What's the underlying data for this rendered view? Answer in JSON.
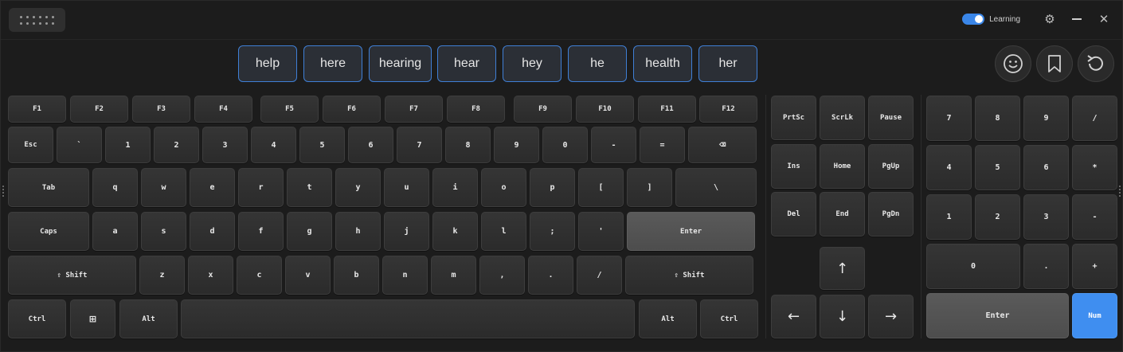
{
  "titlebar": {
    "learning_label": "Learning",
    "learning_on": true,
    "settings_icon": "gear-icon",
    "minimize_icon": "minimize-icon",
    "close_icon": "close-icon",
    "close_glyph": "✕",
    "gear_glyph": "⚙"
  },
  "suggestions": [
    "help",
    "here",
    "hearing",
    "hear",
    "hey",
    "he",
    "health",
    "her"
  ],
  "tools": [
    "emoji-icon",
    "bookmark-icon",
    "reset-icon"
  ],
  "main_keys": {
    "function_row": [
      "F1",
      "F2",
      "F3",
      "F4",
      "F5",
      "F6",
      "F7",
      "F8",
      "F9",
      "F10",
      "F11",
      "F12"
    ],
    "number_row": [
      "Esc",
      "`",
      "1",
      "2",
      "3",
      "4",
      "5",
      "6",
      "7",
      "8",
      "9",
      "0",
      "-",
      "=",
      "⌫"
    ],
    "q_row": [
      "Tab",
      "q",
      "w",
      "e",
      "r",
      "t",
      "y",
      "u",
      "i",
      "o",
      "p",
      "[",
      "]",
      "\\"
    ],
    "a_row": [
      "Caps",
      "a",
      "s",
      "d",
      "f",
      "g",
      "h",
      "j",
      "k",
      "l",
      ";",
      "'",
      "Enter"
    ],
    "z_row": [
      "⇧ Shift",
      "z",
      "x",
      "c",
      "v",
      "b",
      "n",
      "m",
      ",",
      ".",
      "/",
      "⇧ Shift"
    ],
    "bottom_row": [
      "Ctrl",
      "⊞",
      "Alt",
      "",
      "Alt",
      "Ctrl"
    ]
  },
  "nav_keys": {
    "row1": [
      "PrtSc",
      "ScrLk",
      "Pause"
    ],
    "row2": [
      "Ins",
      "Home",
      "PgUp"
    ],
    "row3": [
      "Del",
      "End",
      "PgDn"
    ],
    "arrows": {
      "up": "↑",
      "left": "←",
      "down": "↓",
      "right": "→"
    }
  },
  "numpad": {
    "row1": [
      "7",
      "8",
      "9",
      "/"
    ],
    "row2": [
      "4",
      "5",
      "6",
      "*"
    ],
    "row3": [
      "1",
      "2",
      "3",
      "-"
    ],
    "row4": [
      "0",
      ".",
      "+"
    ],
    "row5": [
      "Enter",
      "Num"
    ]
  },
  "colors": {
    "accent": "#3f8ef0",
    "background": "#1c1c1c",
    "key": "#303030"
  }
}
